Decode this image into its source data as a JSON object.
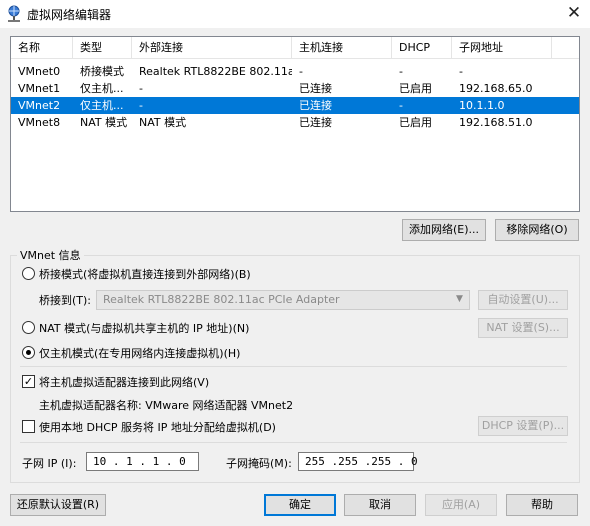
{
  "window": {
    "title": "虚拟网络编辑器",
    "close_glyph": "✕"
  },
  "list": {
    "columns": [
      "名称",
      "类型",
      "外部连接",
      "主机连接",
      "DHCP",
      "子网地址"
    ],
    "rows": [
      {
        "name": "VMnet0",
        "type": "桥接模式",
        "external": "Realtek RTL8822BE 802.11a...",
        "host": "-",
        "dhcp": "-",
        "subnet": "-",
        "selected": false
      },
      {
        "name": "VMnet1",
        "type": "仅主机...",
        "external": "-",
        "host": "已连接",
        "dhcp": "已启用",
        "subnet": "192.168.65.0",
        "selected": false
      },
      {
        "name": "VMnet2",
        "type": "仅主机...",
        "external": "-",
        "host": "已连接",
        "dhcp": "-",
        "subnet": "10.1.1.0",
        "selected": true
      },
      {
        "name": "VMnet8",
        "type": "NAT 模式",
        "external": "NAT 模式",
        "host": "已连接",
        "dhcp": "已启用",
        "subnet": "192.168.51.0",
        "selected": false
      }
    ]
  },
  "buttons": {
    "add_network": "添加网络(E)...",
    "remove_network": "移除网络(O)",
    "auto_settings": "自动设置(U)...",
    "nat_settings": "NAT 设置(S)...",
    "dhcp_settings": "DHCP 设置(P)...",
    "restore_defaults": "还原默认设置(R)",
    "ok": "确定",
    "cancel": "取消",
    "apply": "应用(A)",
    "help": "帮助"
  },
  "vmnet_info": {
    "legend": "VMnet 信息",
    "bridged_label": "桥接模式(将虚拟机直接连接到外部网络)(B)",
    "bridge_to_label": "桥接到(T):",
    "bridge_to_value": "Realtek RTL8822BE 802.11ac PCIe Adapter",
    "nat_label": "NAT 模式(与虚拟机共享主机的 IP 地址)(N)",
    "host_only_label": "仅主机模式(在专用网络内连接虚拟机)(H)",
    "selected_mode": "host_only",
    "connect_adapter_label": "将主机虚拟适配器连接到此网络(V)",
    "connect_adapter_checked": true,
    "adapter_name_text": "主机虚拟适配器名称: VMware 网络适配器 VMnet2",
    "use_dhcp_label": "使用本地 DHCP 服务将 IP 地址分配给虚拟机(D)",
    "use_dhcp_checked": false,
    "subnet_ip_label": "子网 IP (I):",
    "subnet_ip_value": "10 . 1 . 1 . 0",
    "subnet_mask_label": "子网掩码(M):",
    "subnet_mask_value": "255 .255 .255 . 0"
  },
  "colors": {
    "selection": "#0078d7",
    "window_bg": "#f0f0f0"
  },
  "icons": {
    "title": "network-editor-icon",
    "dropdown": "chevron-down-icon"
  }
}
